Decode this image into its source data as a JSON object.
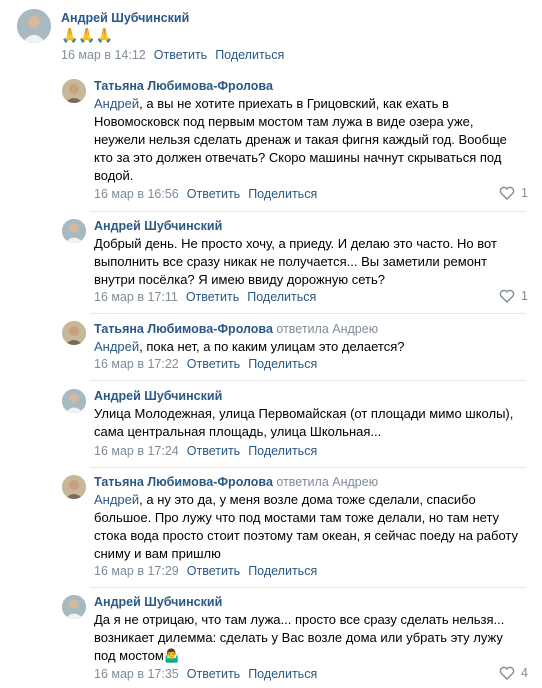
{
  "post": {
    "author": "Андрей Шубчинский",
    "text": "🙏🙏🙏",
    "date": "16 мар в 14:12",
    "reply_label": "Ответить",
    "share_label": "Поделиться"
  },
  "replies": [
    {
      "author": "Татьяна Любимова-Фролова",
      "replied_to": "",
      "mention": "Андрей",
      "text": ", а вы не хотите приехать в Грицовский, как ехать в Новомосковск под первым мостом там лужа в виде озера уже, неужели нельзя сделать дренаж и такая фигня каждый год. Вообще кто за это должен отвечать? Скоро машины начнут скрываться под водой.",
      "date": "16 мар в 16:56",
      "reply_label": "Ответить",
      "share_label": "Поделиться",
      "likes": "1"
    },
    {
      "author": "Андрей Шубчинский",
      "replied_to": "",
      "mention": "",
      "text": "Добрый день. Не просто хочу, а приеду. И делаю это часто. Но вот выполнить все сразу никак не получается... Вы заметили ремонт внутри посёлка? Я имею ввиду дорожную сеть?",
      "date": "16 мар в 17:11",
      "reply_label": "Ответить",
      "share_label": "Поделиться",
      "likes": "1"
    },
    {
      "author": "Татьяна Любимова-Фролова",
      "replied_to": "ответила Андрею",
      "mention": "Андрей",
      "text": ", пока нет, а по каким улицам это делается?",
      "date": "16 мар в 17:22",
      "reply_label": "Ответить",
      "share_label": "Поделиться",
      "likes": ""
    },
    {
      "author": "Андрей Шубчинский",
      "replied_to": "",
      "mention": "",
      "text": "Улица Молодежная, улица Первомайская (от площади мимо школы), сама центральная площадь, улица Школьная...",
      "date": "16 мар в 17:24",
      "reply_label": "Ответить",
      "share_label": "Поделиться",
      "likes": ""
    },
    {
      "author": "Татьяна Любимова-Фролова",
      "replied_to": "ответила Андрею",
      "mention": "Андрей",
      "text": ", а ну это да, у меня возле дома тоже сделали, спасибо большое. Про лужу что под мостами там тоже делали, но там нету стока вода просто стоит поэтому там океан, я сейчас поеду на работу сниму и вам пришлю",
      "date": "16 мар в 17:29",
      "reply_label": "Ответить",
      "share_label": "Поделиться",
      "likes": ""
    },
    {
      "author": "Андрей Шубчинский",
      "replied_to": "",
      "mention": "",
      "text": "Да я не отрицаю, что там лужа... просто все сразу сделать нельзя... возникает дилемма: сделать у Вас возле дома или убрать эту лужу под мостом🤷‍♂️",
      "date": "16 мар в 17:35",
      "reply_label": "Ответить",
      "share_label": "Поделиться",
      "likes": "4"
    }
  ]
}
